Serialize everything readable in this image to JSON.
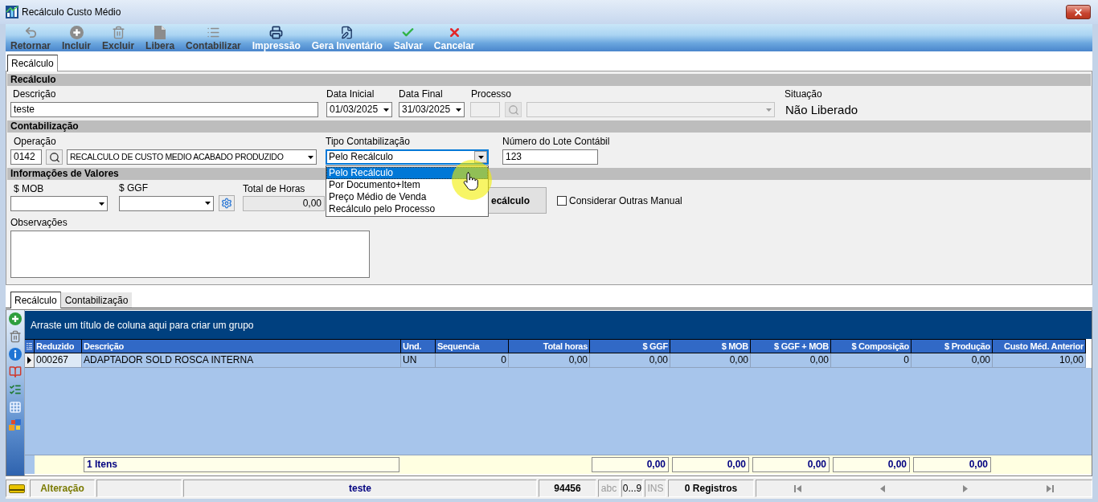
{
  "window": {
    "title": "Recálculo Custo Médio"
  },
  "toolbar": [
    {
      "label": "Retornar",
      "disabled": true
    },
    {
      "label": "Incluir",
      "disabled": true
    },
    {
      "label": "Excluir",
      "disabled": true
    },
    {
      "label": "Libera",
      "disabled": true
    },
    {
      "label": "Contabilizar",
      "disabled": true
    },
    {
      "label": "Impressão",
      "disabled": false
    },
    {
      "label": "Gera Inventário",
      "disabled": false
    },
    {
      "label": "Salvar",
      "disabled": false
    },
    {
      "label": "Cancelar",
      "disabled": false
    }
  ],
  "tabs": [
    {
      "label": "Recálculo",
      "selected": true
    }
  ],
  "recalculo": {
    "heading": "Recálculo",
    "descricao": {
      "label": "Descrição",
      "value": "teste"
    },
    "data_inicial": {
      "label": "Data Inicial",
      "value": "01/03/2025"
    },
    "data_final": {
      "label": "Data Final",
      "value": "31/03/2025"
    },
    "processo": {
      "label": "Processo",
      "disabled": true
    },
    "situacao": {
      "label": "Situação",
      "value": "Não Liberado"
    }
  },
  "contabilizacao": {
    "heading": "Contabilização",
    "operacao": {
      "label": "Operação",
      "code": "0142",
      "value": "RECALCULO DE CUSTO MEDIO ACABADO PRODUZIDO"
    },
    "tipo": {
      "label": "Tipo Contabilização",
      "value": "Pelo Recálculo",
      "expanded": true,
      "options": [
        {
          "label": "Pelo Recálculo",
          "selected": true
        },
        {
          "label": "Por Documento+Item",
          "selected": false
        },
        {
          "label": "Preço Médio de Venda",
          "selected": false
        },
        {
          "label": "Recálculo pelo Processo",
          "selected": false
        }
      ]
    },
    "lote": {
      "label": "Número do Lote Contábil",
      "value": "123"
    }
  },
  "valores": {
    "heading": "Informações de Valores",
    "mob": {
      "label": "$ MOB"
    },
    "ggf": {
      "label": "$ GGF"
    },
    "total_horas": {
      "label": "Total de Horas",
      "value": "0,00"
    },
    "action_button": {
      "label": "ecálculo"
    },
    "considerar": {
      "label": "Considerar Outras Manual",
      "checked": false
    },
    "observacoes": {
      "label": "Observações"
    }
  },
  "detail_tabs": [
    {
      "label": "Recálculo",
      "selected": true
    },
    {
      "label": "Contabilização",
      "selected": false
    }
  ],
  "grid": {
    "group_hint": "Arraste um título de coluna aqui para criar um grupo",
    "columns": [
      "Reduzido",
      "Descrição",
      "Und.",
      "Sequencia",
      "Total horas",
      "$ GGF",
      "$ MOB",
      "$ GGF + MOB",
      "$ Composição",
      "$ Produção",
      "Custo Méd. Anterior"
    ],
    "rows": [
      {
        "selected": true,
        "cells": [
          "000267",
          "ADAPTADOR SOLD ROSCA INTERNA",
          "UN",
          "0",
          "0,00",
          "0,00",
          "0,00",
          "0,00",
          "0",
          "0,00",
          "10,00"
        ]
      }
    ],
    "footer": {
      "count": "1 Itens",
      "totals": [
        "0,00",
        "0,00",
        "0,00",
        "0,00",
        "0,00"
      ]
    }
  },
  "status_bar": {
    "mode": "Alteração",
    "description": "teste",
    "code": "94456",
    "indicators": [
      {
        "label": "abc",
        "on": false
      },
      {
        "label": "0...9",
        "on": true
      },
      {
        "label": "INS",
        "on": false
      }
    ],
    "records": "0 Registros"
  }
}
